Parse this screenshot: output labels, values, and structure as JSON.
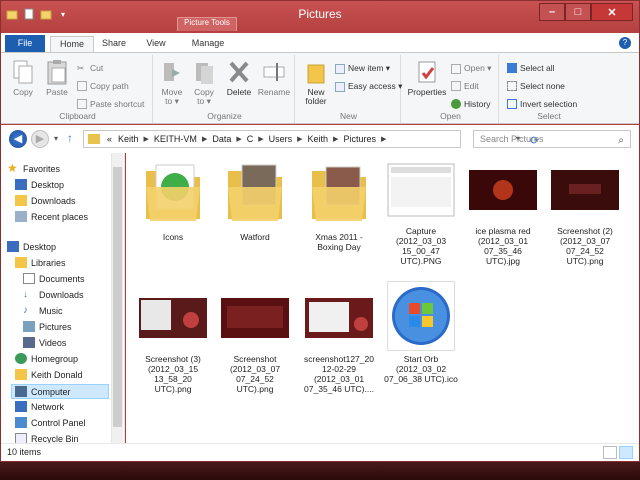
{
  "window": {
    "title": "Pictures",
    "context_tab_group": "Picture Tools",
    "controls": {
      "minimize": "–",
      "maximize": "□",
      "close": "✕"
    }
  },
  "ribbon_tabs": [
    "File",
    "Home",
    "Share",
    "View",
    "Manage"
  ],
  "ribbon": {
    "clipboard": {
      "label": "Clipboard",
      "copy": "Copy",
      "paste": "Paste",
      "cut": "Cut",
      "copy_path": "Copy path",
      "paste_shortcut": "Paste shortcut"
    },
    "organize": {
      "label": "Organize",
      "move_to": "Move to ▾",
      "copy_to": "Copy to ▾",
      "delete": "Delete",
      "rename": "Rename"
    },
    "new": {
      "label": "New",
      "new_folder": "New folder",
      "new_item": "New item ▾",
      "easy_access": "Easy access ▾"
    },
    "open": {
      "label": "Open",
      "properties": "Properties",
      "open": "Open ▾",
      "edit": "Edit",
      "history": "History"
    },
    "select": {
      "label": "Select",
      "select_all": "Select all",
      "select_none": "Select none",
      "invert_selection": "Invert selection"
    }
  },
  "address_bar": {
    "prefix": "«",
    "crumbs": [
      "Keith",
      "KEITH-VM",
      "Data",
      "C",
      "Users",
      "Keith",
      "Pictures"
    ],
    "search_placeholder": "Search Pictures"
  },
  "nav_pane": {
    "favorites": {
      "label": "Favorites",
      "items": [
        "Desktop",
        "Downloads",
        "Recent places"
      ]
    },
    "desktop": {
      "label": "Desktop"
    },
    "libraries": {
      "label": "Libraries",
      "items": [
        "Documents",
        "Downloads",
        "Music",
        "Pictures",
        "Videos"
      ]
    },
    "others": [
      "Homegroup",
      "Keith Donald",
      "Computer",
      "Network",
      "Control Panel",
      "Recycle Bin"
    ],
    "selected": "Computer"
  },
  "items": [
    {
      "name": "Icons",
      "kind": "folder"
    },
    {
      "name": "Watford",
      "kind": "folder"
    },
    {
      "name": "Xmas 2011 - Boxing Day",
      "kind": "folder"
    },
    {
      "name": "Capture (2012_03_03 15_00_47 UTC).PNG",
      "kind": "image"
    },
    {
      "name": "ice plasma red (2012_03_01 07_35_46 UTC).jpg",
      "kind": "image"
    },
    {
      "name": "Screenshot (2) (2012_03_07 07_24_52 UTC).png",
      "kind": "image"
    },
    {
      "name": "Screenshot (3) (2012_03_15 13_58_20 UTC).png",
      "kind": "image"
    },
    {
      "name": "Screenshot (2012_03_07 07_24_52 UTC).png",
      "kind": "image"
    },
    {
      "name": "screenshot127_2012-02-29 (2012_03_01 07_35_46 UTC)....",
      "kind": "image"
    },
    {
      "name": "Start Orb (2012_03_02 07_06_38 UTC).ico",
      "kind": "image"
    }
  ],
  "status": {
    "count": "10 items"
  },
  "colors": {
    "frame": "#b64040",
    "accent": "#1e5eb0",
    "selection": "#cde8ff"
  }
}
